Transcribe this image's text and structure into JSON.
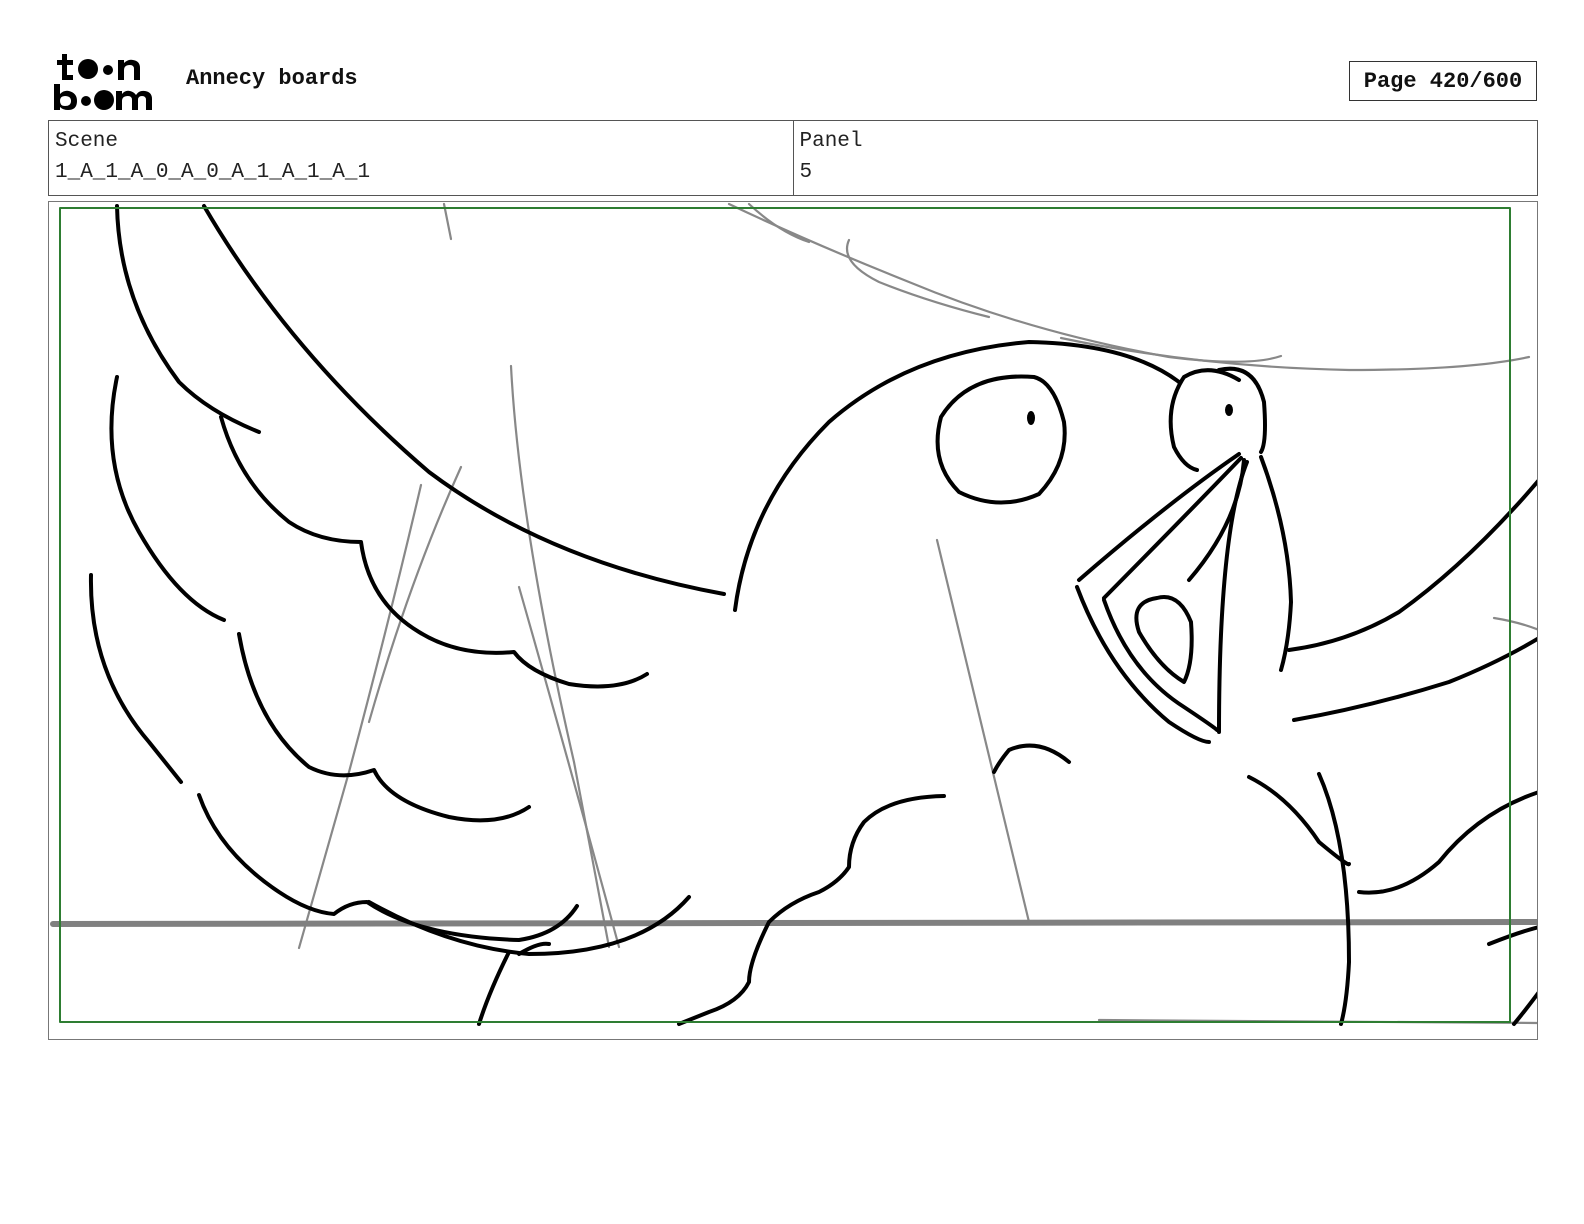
{
  "header": {
    "logo_text": "toon boom",
    "project_title": "Annecy boards",
    "page_label": "Page 420/600"
  },
  "info": {
    "scene_label": "Scene",
    "scene_value": "1_A_1_A_0_A_0_A_1_A_1_A_1",
    "panel_label": "Panel",
    "panel_value": "5"
  },
  "colors": {
    "safe_frame": "#2e7d32",
    "sketch_line": "#000000",
    "guide_line": "#888888"
  }
}
